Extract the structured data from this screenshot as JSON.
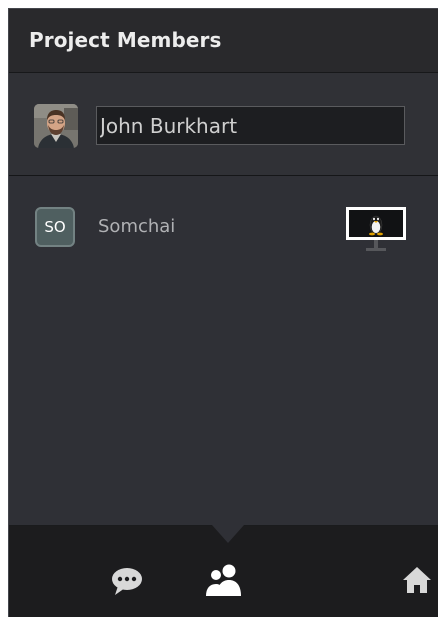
{
  "header": {
    "title": "Project Members"
  },
  "current_user": {
    "avatar": "user-photo-avatar",
    "name_value": "John Burkhart"
  },
  "members": [
    {
      "initials": "SO",
      "name": "Somchai",
      "platform_icon": "linux-monitor-icon"
    }
  ],
  "bottom_nav": {
    "items": [
      {
        "icon": "chat-icon",
        "active": false
      },
      {
        "icon": "people-icon",
        "active": true
      },
      {
        "icon": "home-icon",
        "active": false
      }
    ]
  },
  "colors": {
    "panel_bg": "#2f3036",
    "header_bg": "#29292c",
    "bottom_bar_bg": "#1c1c1e",
    "badge_bg": "#4f5f60",
    "text_primary": "#ededed",
    "text_secondary": "#b0b1b4"
  }
}
